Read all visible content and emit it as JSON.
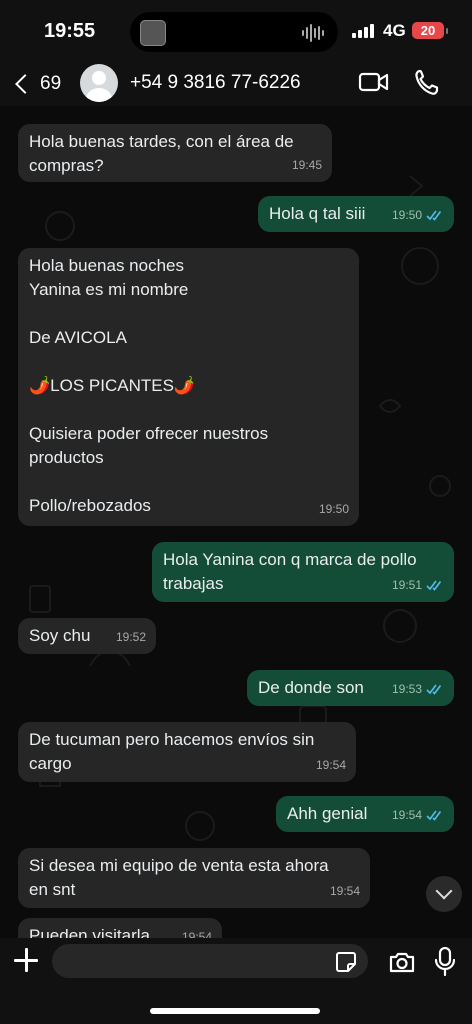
{
  "status_bar": {
    "time": "19:55",
    "network": "4G",
    "battery": "20"
  },
  "header": {
    "back_count": "69",
    "contact_name": "+54 9 3816 77-6226"
  },
  "messages": [
    {
      "dir": "in",
      "text": "Hola buenas tardes, con el área de\ncompras?",
      "time": "19:45"
    },
    {
      "dir": "out",
      "text": "Hola q tal siii",
      "time": "19:50",
      "read": true
    },
    {
      "dir": "in",
      "text": "Hola buenas noches\nYanina es mi nombre\n\nDe AVICOLA\n\n🌶️LOS PICANTES🌶️\n\nQuisiera poder ofrecer nuestros\nproductos\n\nPollo/rebozados",
      "time": "19:50"
    },
    {
      "dir": "out",
      "text": "Hola Yanina con q marca de pollo\ntrabajas",
      "time": "19:51",
      "read": true
    },
    {
      "dir": "in",
      "text": "Soy chu",
      "time": "19:52"
    },
    {
      "dir": "out",
      "text": "De donde son",
      "time": "19:53",
      "read": true
    },
    {
      "dir": "in",
      "text": "De tucuman pero hacemos envíos sin\ncargo",
      "time": "19:54"
    },
    {
      "dir": "out",
      "text": "Ahh genial",
      "time": "19:54",
      "read": true
    },
    {
      "dir": "in",
      "text": "Si desea mi equipo de venta esta ahora\nen snt",
      "time": "19:54"
    },
    {
      "dir": "in",
      "text": "Pueden visitarla",
      "time": "19:54"
    }
  ],
  "icons": {
    "back": "chevron-left-icon",
    "video": "video-camera-icon",
    "call": "phone-icon",
    "scroll": "chevron-down-icon",
    "attach": "plus-icon",
    "sticker": "sticker-icon",
    "camera": "camera-icon",
    "mic": "microphone-icon",
    "read": "double-check-icon"
  },
  "colors": {
    "incoming_bubble": "#262626",
    "outgoing_bubble": "#144d37",
    "read_ticks": "#53bdeb",
    "battery": "#e8474a"
  }
}
